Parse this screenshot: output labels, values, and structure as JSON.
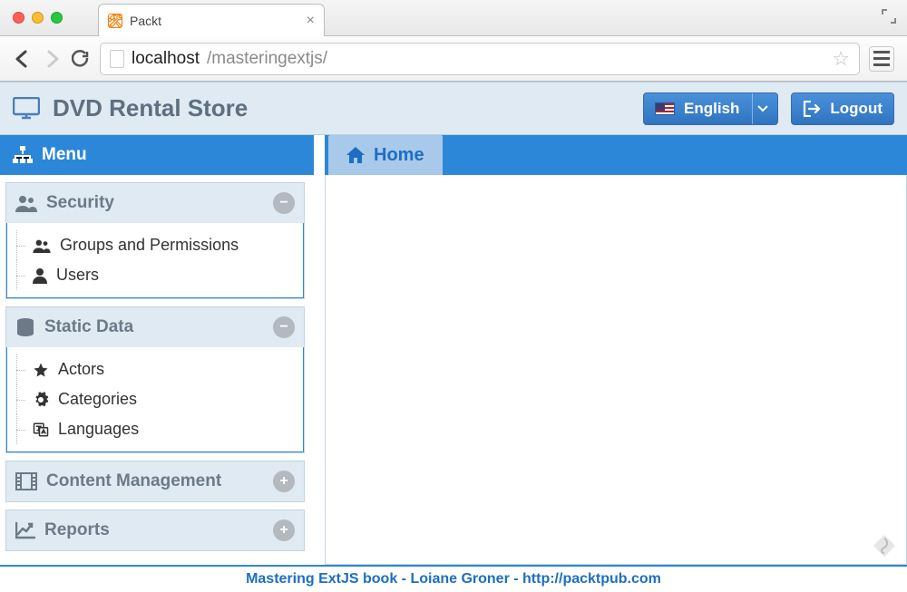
{
  "browser": {
    "tab_title": "Packt",
    "url_host": "localhost",
    "url_path": "/masteringextjs/"
  },
  "header": {
    "title": "DVD Rental Store",
    "language_label": "English",
    "logout_label": "Logout"
  },
  "sidebar": {
    "menu_label": "Menu",
    "panels": [
      {
        "title": "Security",
        "expanded": true,
        "items": [
          {
            "label": "Groups and Permissions",
            "icon": "users-icon"
          },
          {
            "label": "Users",
            "icon": "user-icon"
          }
        ]
      },
      {
        "title": "Static Data",
        "expanded": true,
        "items": [
          {
            "label": "Actors",
            "icon": "star-icon"
          },
          {
            "label": "Categories",
            "icon": "gear-icon"
          },
          {
            "label": "Languages",
            "icon": "language-icon"
          }
        ]
      },
      {
        "title": "Content Management",
        "expanded": false,
        "items": []
      },
      {
        "title": "Reports",
        "expanded": false,
        "items": []
      }
    ]
  },
  "tabs": {
    "active": {
      "label": "Home"
    }
  },
  "footer": {
    "text": "Mastering ExtJS book - Loiane Groner - http://packtpub.com"
  }
}
